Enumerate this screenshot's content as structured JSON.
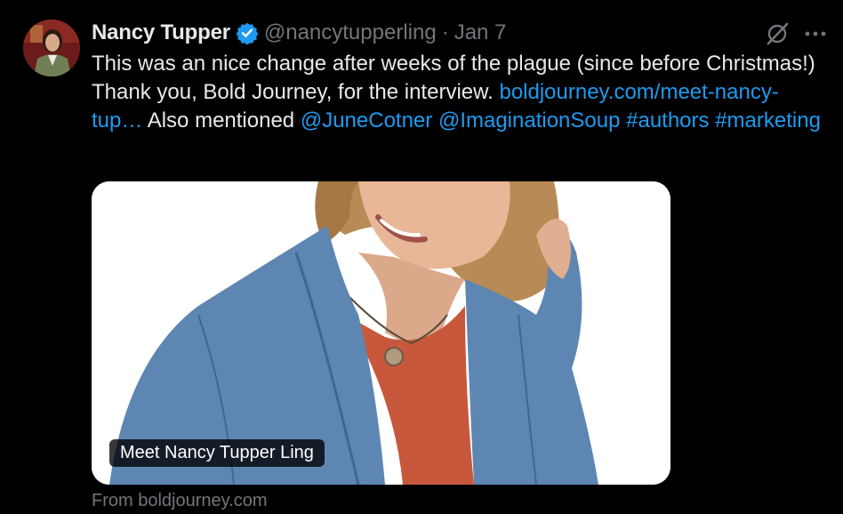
{
  "tweet": {
    "author_name": "Nancy Tupper",
    "author_handle": "@nancytupperling",
    "separator": "·",
    "date": "Jan 7",
    "text_line1": "This was an nice change after weeks of the plague (since before Christmas!)",
    "text_intro": "Thank you, Bold Journey, for the interview. ",
    "link_url": "boldjourney.com/meet-nancy-tup…",
    "text_mid": " Also mentioned ",
    "mention1": "@JuneCotner",
    "mention2": "@ImaginationSoup",
    "hashtag1": "#authors",
    "hashtag2": "#marketing"
  },
  "card": {
    "title": "Meet Nancy Tupper Ling",
    "source": "From boldjourney.com"
  },
  "icons": {
    "verified": "verified-badge-icon",
    "grok": "grok-icon",
    "more": "more-icon"
  },
  "colors": {
    "background": "#000000",
    "text": "#e7e9ea",
    "secondary": "#71767b",
    "link": "#1d9bf0"
  }
}
